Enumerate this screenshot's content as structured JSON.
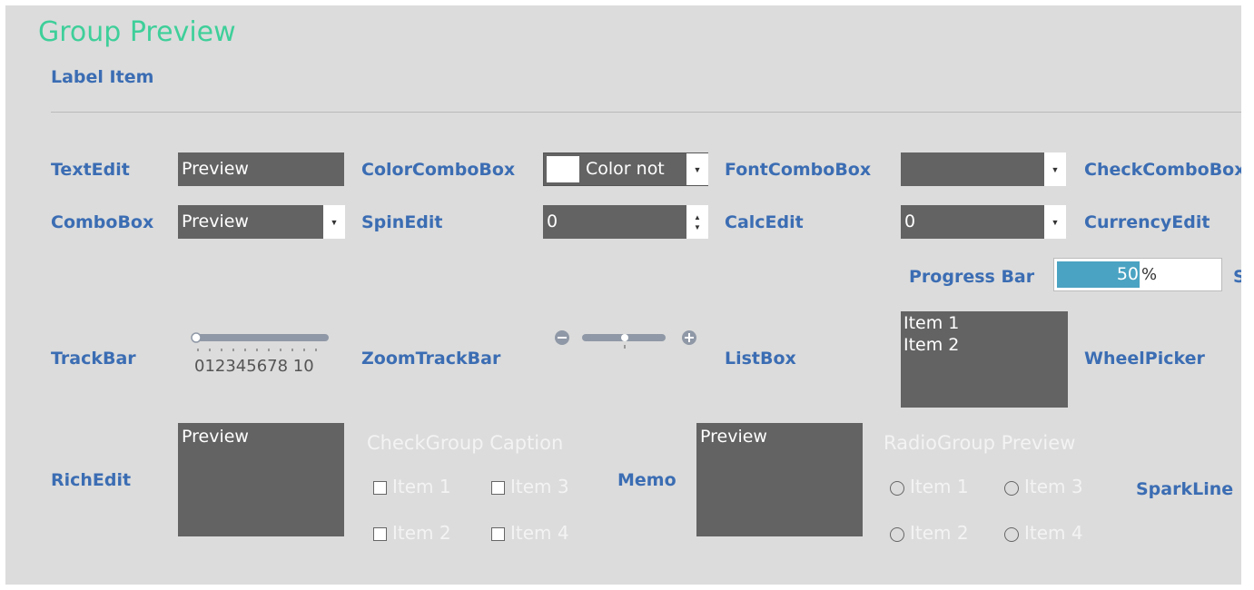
{
  "header": {
    "title": "Group Preview",
    "label_item": "Label Item"
  },
  "row1": {
    "textedit_label": "TextEdit",
    "textedit_value": "Preview",
    "colorcombo_label": "ColorComboBox",
    "colorcombo_value": "Color not",
    "fontcombo_label": "FontComboBox",
    "fontcombo_value": "",
    "checkcombo_label": "CheckComboBox"
  },
  "row2": {
    "combobox_label": "ComboBox",
    "combobox_value": "Preview",
    "spinedit_label": "SpinEdit",
    "spinedit_value": "0",
    "calcedit_label": "CalcEdit",
    "calcedit_value": "0",
    "currencyedit_label": "CurrencyEdit"
  },
  "progress": {
    "label": "Progress Bar",
    "value": "50",
    "unit": "%",
    "fraction": 0.5,
    "cut_label": "S"
  },
  "row3": {
    "trackbar_label": "TrackBar",
    "trackbar_scale": "012345678 10",
    "zoomtrackbar_label": "ZoomTrackBar",
    "listbox_label": "ListBox",
    "listbox_items": [
      "Item 1",
      "Item 2"
    ],
    "wheelpicker_label": "WheelPicker"
  },
  "row4": {
    "richedit_label": "RichEdit",
    "richedit_value": "Preview",
    "checkgroup_caption": "CheckGroup Caption",
    "checkgroup_items": [
      "Item 1",
      "Item 3",
      "Item 2",
      "Item 4"
    ],
    "memo_label": "Memo",
    "memo_value": "Preview",
    "radiogroup_caption": "RadioGroup Preview",
    "radiogroup_items": [
      "Item 1",
      "Item 3",
      "Item 2",
      "Item 4"
    ],
    "sparkline_label": "SparkLine"
  },
  "colors": {
    "accent_title": "#3ecf9a",
    "label_blue": "#3b6db3",
    "editor_bg": "#636363",
    "progress_fill": "#4aa3c2"
  }
}
